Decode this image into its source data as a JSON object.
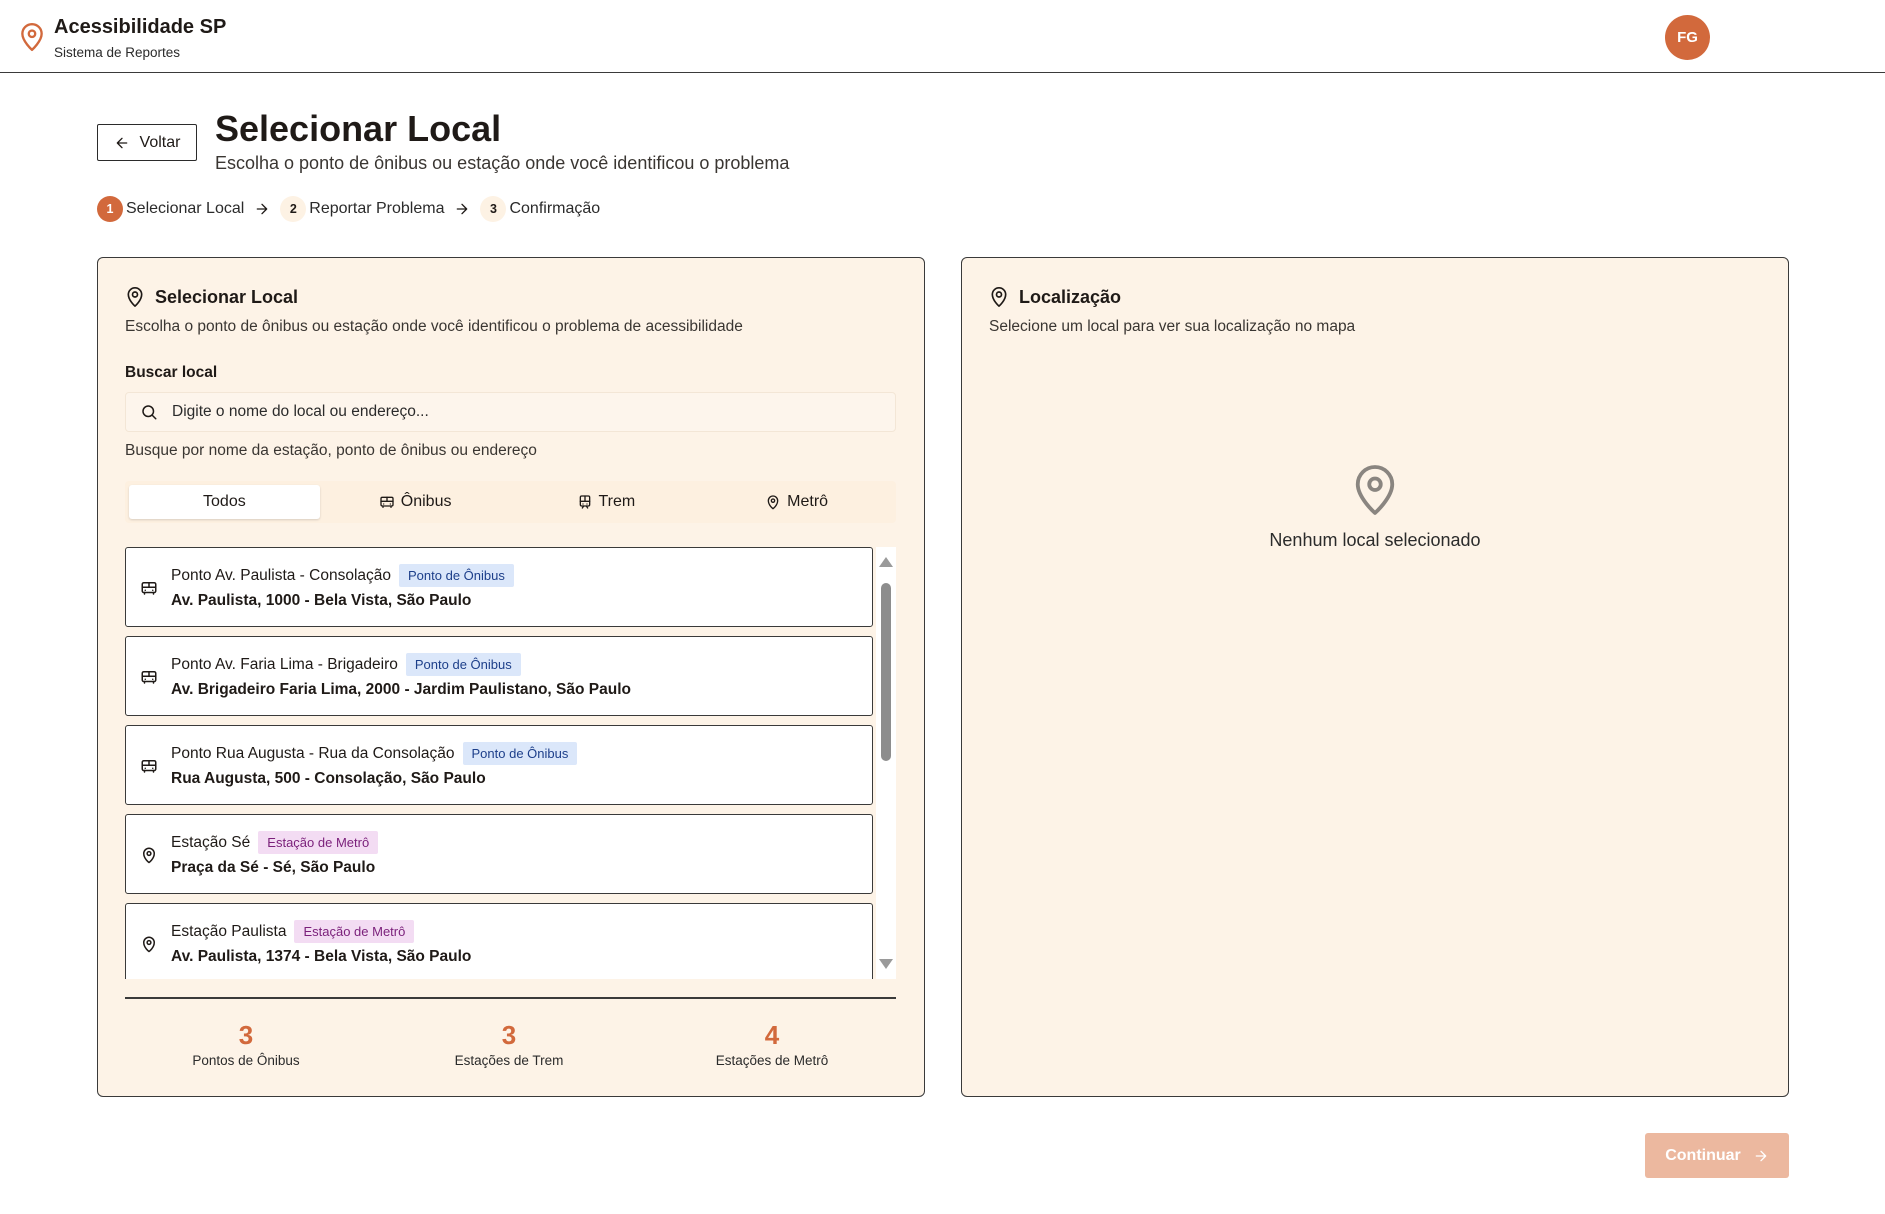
{
  "header": {
    "title": "Acessibilidade SP",
    "subtitle": "Sistema de Reportes",
    "avatar_initials": "FG",
    "brand_icon": "map-pin-icon"
  },
  "page": {
    "back_label": "Voltar",
    "title": "Selecionar Local",
    "subtitle": "Escolha o ponto de ônibus ou estação onde você identificou o problema"
  },
  "stepper": {
    "steps": [
      {
        "num": "1",
        "label": "Selecionar Local",
        "active": true
      },
      {
        "num": "2",
        "label": "Reportar Problema",
        "active": false
      },
      {
        "num": "3",
        "label": "Confirmação",
        "active": false
      }
    ]
  },
  "select_card": {
    "title": "Selecionar Local",
    "description": "Escolha o ponto de ônibus ou estação onde você identificou o problema de acessibilidade",
    "search_label": "Buscar local",
    "search_placeholder": "Digite o nome do local ou endereço...",
    "search_value": "",
    "search_hint": "Busque por nome da estação, ponto de ônibus ou endereço",
    "filters": [
      {
        "label": "Todos",
        "icon": "",
        "active": true
      },
      {
        "label": "Ônibus",
        "icon": "bus-icon",
        "active": false
      },
      {
        "label": "Trem",
        "icon": "train-icon",
        "active": false
      },
      {
        "label": "Metrô",
        "icon": "map-pin-icon",
        "active": false
      }
    ],
    "locations": [
      {
        "name": "Ponto Av. Paulista - Consolação",
        "badge": "Ponto de Ônibus",
        "type": "bus",
        "address": "Av. Paulista, 1000 - Bela Vista, São Paulo"
      },
      {
        "name": "Ponto Av. Faria Lima - Brigadeiro",
        "badge": "Ponto de Ônibus",
        "type": "bus",
        "address": "Av. Brigadeiro Faria Lima, 2000 - Jardim Paulistano, São Paulo"
      },
      {
        "name": "Ponto Rua Augusta - Rua da Consolação",
        "badge": "Ponto de Ônibus",
        "type": "bus",
        "address": "Rua Augusta, 500 - Consolação, São Paulo"
      },
      {
        "name": "Estação Sé",
        "badge": "Estação de Metrô",
        "type": "metro",
        "address": "Praça da Sé - Sé, São Paulo"
      },
      {
        "name": "Estação Paulista",
        "badge": "Estação de Metrô",
        "type": "metro",
        "address": "Av. Paulista, 1374 - Bela Vista, São Paulo"
      }
    ],
    "stats": [
      {
        "value": "3",
        "label": "Pontos de Ônibus"
      },
      {
        "value": "3",
        "label": "Estações de Trem"
      },
      {
        "value": "4",
        "label": "Estações de Metrô"
      }
    ]
  },
  "location_card": {
    "title": "Localização",
    "description": "Selecione um local para ver sua localização no mapa",
    "empty_text": "Nenhum local selecionado"
  },
  "continue_label": "Continuar",
  "colors": {
    "accent": "#d2693c",
    "card_bg": "#fdf3e7",
    "bus_badge_bg": "#dbe7fa",
    "metro_badge_bg": "#f3dcf3",
    "continue_disabled": "#ecb89f"
  }
}
